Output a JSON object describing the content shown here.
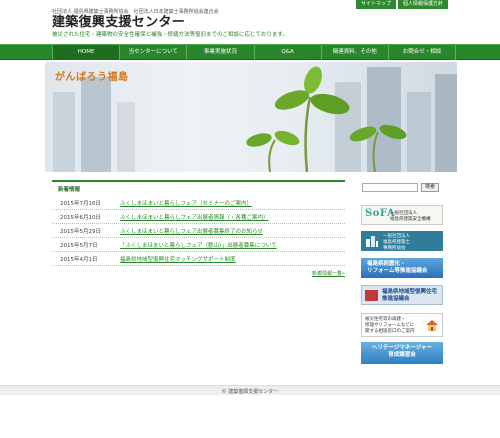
{
  "top_links": [
    "サイトマップ",
    "個人情報保護方針"
  ],
  "header": {
    "orgs": "社団法人 福島県建築士事務所協会　社団法人日本建築士事務所協会連合会",
    "title": "建築復興支援センター",
    "tagline": "被災された住宅・建築物の安全性確保と補強・修繕方法等復旧までのご相談に応じております。"
  },
  "nav": {
    "items": [
      {
        "label": "HOME",
        "active": true
      },
      {
        "label": "当センターについて",
        "active": false
      },
      {
        "label": "事業実施状況",
        "active": false
      },
      {
        "label": "Q&A",
        "active": false
      },
      {
        "label": "関連資料、その他",
        "active": false
      },
      {
        "label": "お問合せ・相談",
        "active": false
      }
    ]
  },
  "hero": {
    "title": "がんばろう福島"
  },
  "news": {
    "heading": "新着情報",
    "items": [
      {
        "date": "2015年7月16日",
        "text": "ふくしまほまいと暮らしフェア（セミナーのご案内）"
      },
      {
        "date": "2015年6月10日",
        "text": "ふくしまほまいと暮らしフェア出展者情報（・各種ご案内）"
      },
      {
        "date": "2015年5月29日",
        "text": "ふくしまほまいと暮らしフェア出展者募集終了のお知らせ"
      },
      {
        "date": "2015年5月7日",
        "text": "「ふくしまほまいと暮らしフェア（郡山）」出展者募集について"
      },
      {
        "date": "2015年4月1日",
        "text": "福島県地域型復興住宅マッチングサポート制度"
      }
    ],
    "more": "新着情報一覧»"
  },
  "search": {
    "placeholder": "",
    "button": "検索"
  },
  "banners": {
    "sofa_logo": "SoFA",
    "sofa_text": "一般社団法人\n福島県建築安全機構",
    "b2_text": "一般社団法人\n福島県建築士\n事務所協会",
    "b3_text": "福島県耐震化・\nリフォーム等推進協議会",
    "b4_text": "福島県地域型復興住宅\n推進協議会",
    "b5_text": "被災住宅等の再建・\n修理やリフォームなどに\n関する相談窓口のご案内",
    "b6_text": "ヘリテージマネージャー\n育成講習会"
  },
  "footer": {
    "copyright": "© 建築復興支援センター"
  },
  "colors": {
    "nav_green": "#2a862a",
    "hero_title": "#d8761a",
    "link_green": "#2a8a2a"
  }
}
